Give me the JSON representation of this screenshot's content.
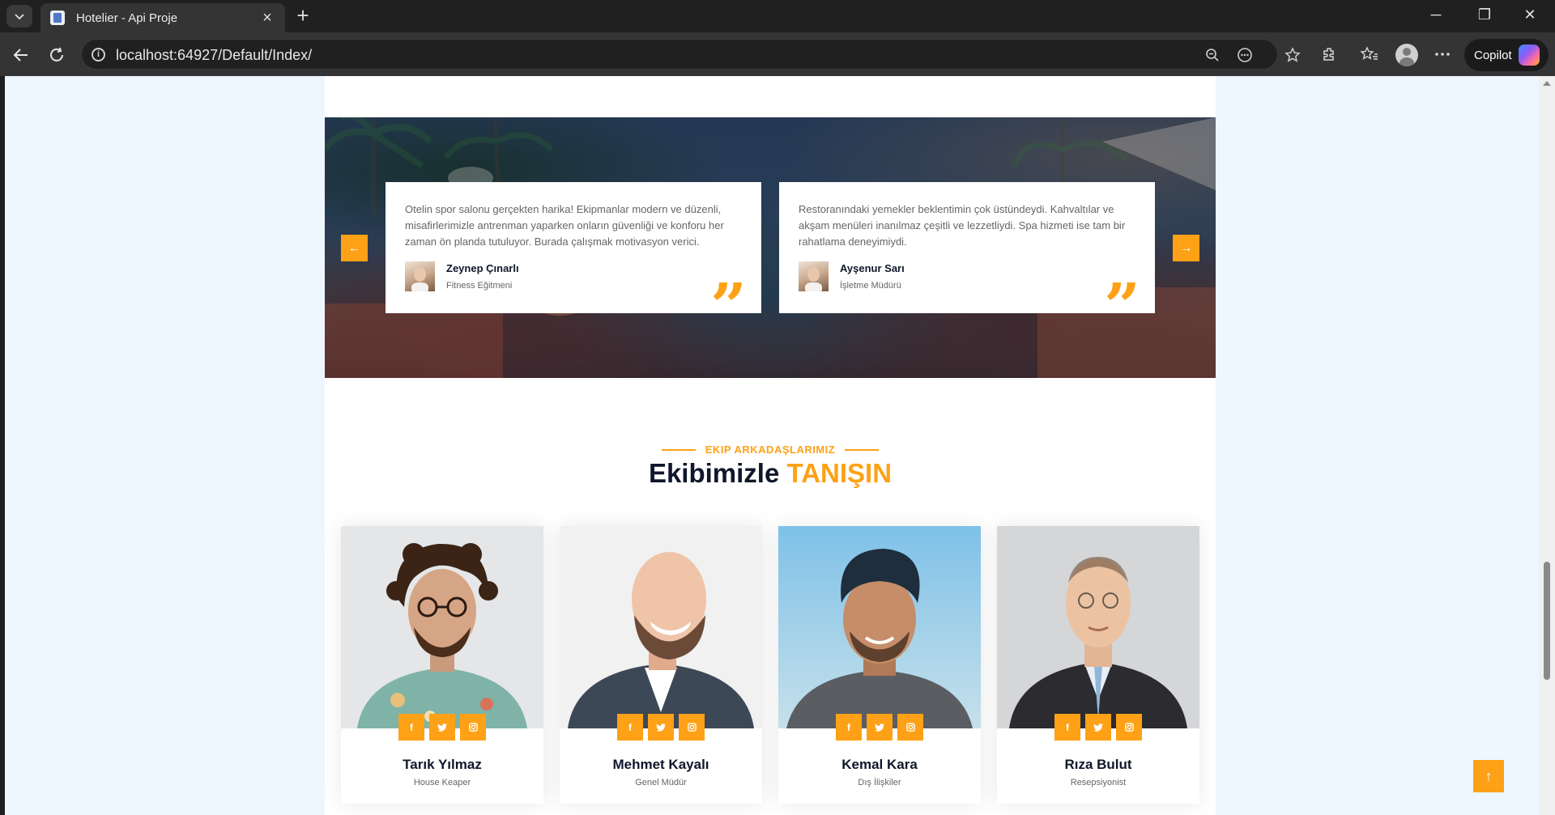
{
  "browser": {
    "tab_title": "Hotelier - Api Proje",
    "url": "localhost:64927/Default/Index/",
    "copilot_label": "Copilot"
  },
  "testimonials": [
    {
      "text": "Otelin spor salonu gerçekten harika! Ekipmanlar modern ve düzenli, misafirlerimizle antrenman yaparken onların güvenliği ve konforu her zaman ön planda tutuluyor. Burada çalışmak motivasyon verici.",
      "name": "Zeynep Çınarlı",
      "title": "Fitness Eğitmeni"
    },
    {
      "text": "Restoranındaki yemekler beklentimin çok üstündeydi. Kahvaltılar ve akşam menüleri inanılmaz çeşitli ve lezzetliydi. Spa hizmeti ise tam bir rahatlama deneyimiydi.",
      "name": "Ayşenur Sarı",
      "title": "İşletme Müdürü"
    }
  ],
  "team_section": {
    "eyebrow": "EKIP ARKADAŞLARIMIZ",
    "title_main": "Ekibimizle",
    "title_accent": "TANIŞIN",
    "members": [
      {
        "name": "Tarık Yılmaz",
        "role": "House Keaper"
      },
      {
        "name": "Mehmet Kayalı",
        "role": "Genel Müdür"
      },
      {
        "name": "Kemal Kara",
        "role": "Dış İlişkiler"
      },
      {
        "name": "Rıza Bulut",
        "role": "Resepsiyonist"
      }
    ]
  },
  "colors": {
    "accent": "#fea116",
    "dark": "#0f172b"
  }
}
